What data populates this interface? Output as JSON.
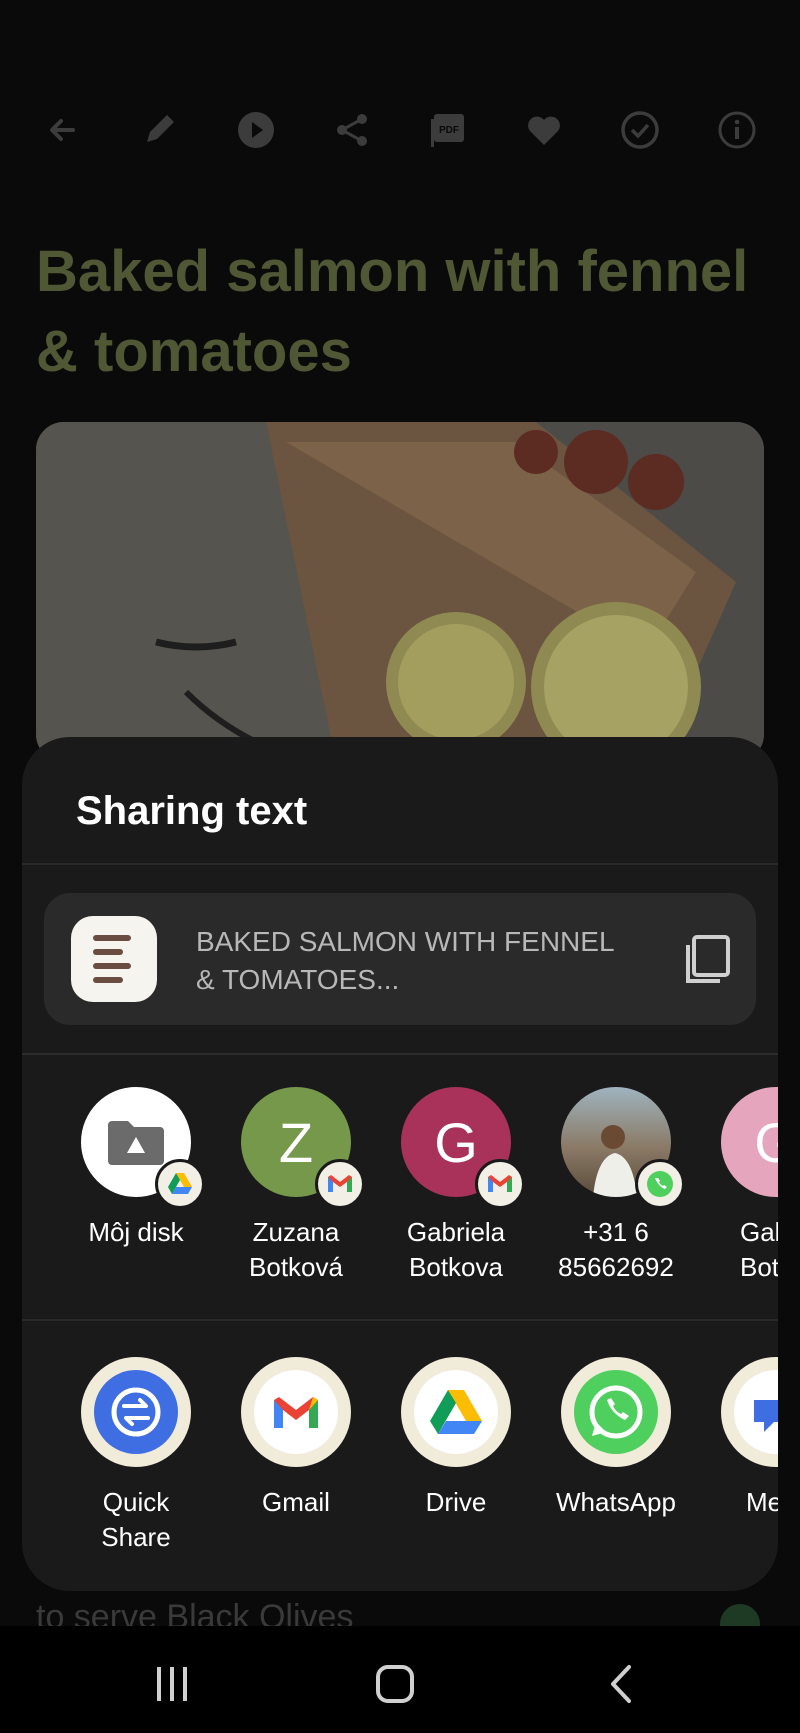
{
  "toolbar": {
    "icons": [
      "back-arrow-icon",
      "edit-pencil-icon",
      "play-icon",
      "share-icon",
      "pdf-icon",
      "heart-icon",
      "check-circle-icon",
      "info-icon"
    ]
  },
  "recipe": {
    "title": "Baked salmon with fennel & tomatoes",
    "ingredient_peek": "to serve Black Olives"
  },
  "share_sheet": {
    "title": "Sharing text",
    "preview_text": "BAKED SALMON WITH FENNEL & TOMATOES...",
    "contacts": [
      {
        "label": "Môj disk",
        "avatar": "folder-icon",
        "badge": "google-drive-icon",
        "color": "#ffffff"
      },
      {
        "label": "Zuzana\nBotková",
        "initial": "Z",
        "badge": "gmail-icon",
        "color": "#76984a"
      },
      {
        "label": "Gabriela\nBotkova",
        "initial": "G",
        "badge": "gmail-icon",
        "color": "#a8325a"
      },
      {
        "label": "+31 6\n85662692",
        "avatar": "photo-avatar",
        "badge": "whatsapp-icon",
        "color": "#8a7a66"
      },
      {
        "label": "Gab\nBotk",
        "initial": "G",
        "color": "#e5a6bd"
      }
    ],
    "apps": [
      {
        "label": "Quick\nShare",
        "icon": "quick-share-icon"
      },
      {
        "label": "Gmail",
        "icon": "gmail-icon"
      },
      {
        "label": "Drive",
        "icon": "google-drive-icon"
      },
      {
        "label": "WhatsApp",
        "icon": "whatsapp-icon"
      },
      {
        "label": "Mess",
        "icon": "messages-icon"
      }
    ]
  },
  "navbar": {
    "buttons": [
      "recent-apps-icon",
      "home-icon",
      "back-icon"
    ]
  }
}
